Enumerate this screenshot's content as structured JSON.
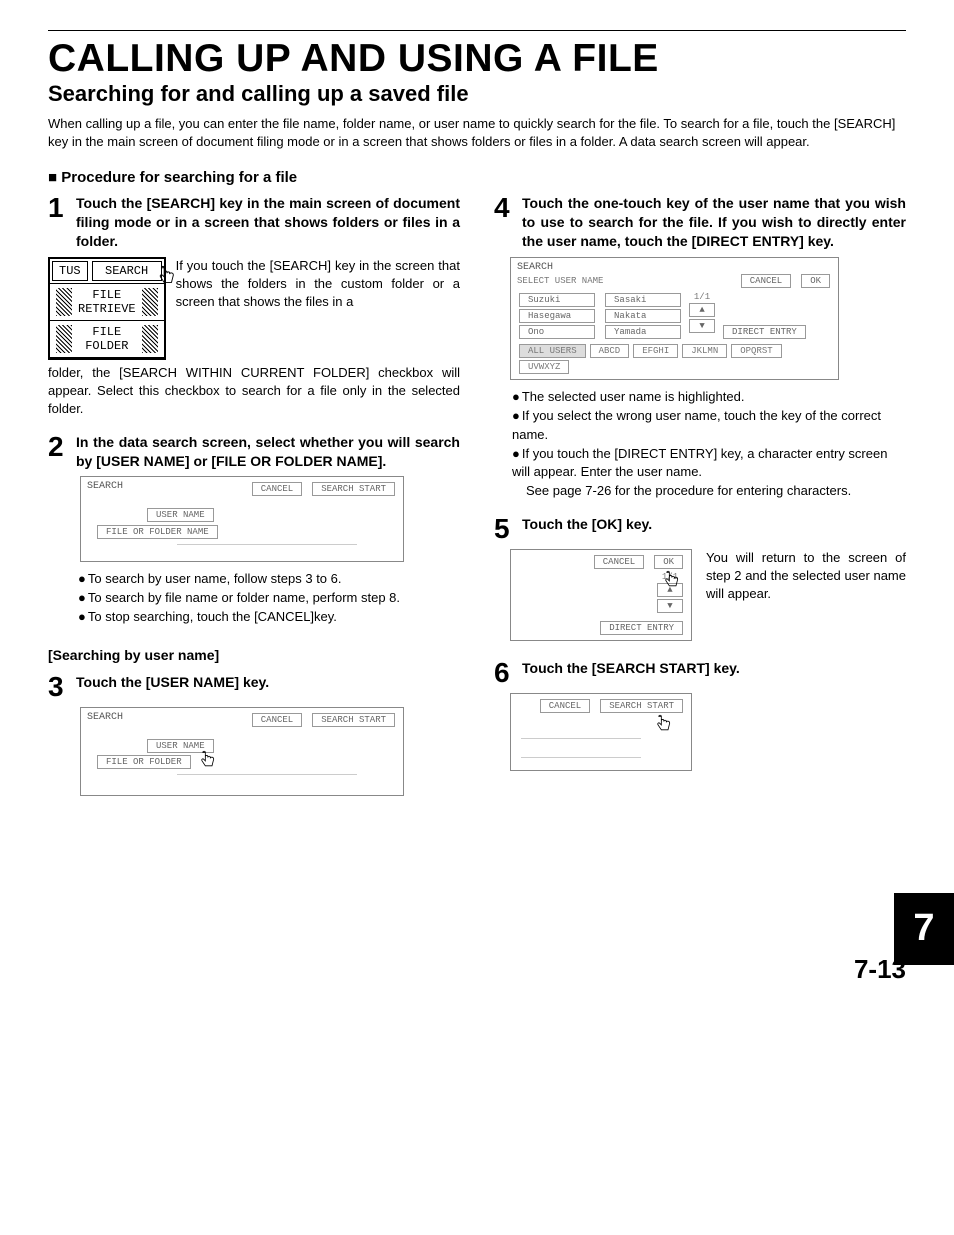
{
  "title": "CALLING UP AND USING A FILE",
  "subtitle": "Searching for and calling up a saved file",
  "intro": "When calling up a file, you can enter the file name, folder name, or user name to quickly search for the file. To search for a file, touch the [SEARCH] key in the main screen of document filing mode or in a screen that shows folders or files in a folder. A data search screen will appear.",
  "proc_heading": "Procedure for searching for a file",
  "step1": {
    "h": "Touch the [SEARCH] key in the main screen of document filing mode or in a screen that shows folders or files in a folder.",
    "body": "If you touch the [SEARCH] key in the screen that shows the folders in the custom folder or a screen that shows the files in a folder, the [SEARCH WITHIN CURRENT FOLDER] checkbox will appear. Select this checkbox to search for a file only in the selected folder.",
    "tab1": "TUS",
    "tab2": "SEARCH",
    "row2": "FILE RETRIEVE",
    "row3": "FILE FOLDER"
  },
  "step2": {
    "h": "In the data search screen, select whether you will search by [USER NAME] or [FILE OR FOLDER NAME].",
    "panel_title": "SEARCH",
    "cancel": "CANCEL",
    "start": "SEARCH START",
    "uname": "USER NAME",
    "forf": "FILE OR FOLDER NAME",
    "b1": "To search by user name, follow steps 3 to 6.",
    "b2": "To search by file name or folder name, perform step 8.",
    "b3": "To stop searching, touch the [CANCEL]key."
  },
  "sub_search_user": "[Searching by user name]",
  "step3": {
    "h": "Touch the [USER NAME] key.",
    "panel_title": "SEARCH",
    "cancel": "CANCEL",
    "start": "SEARCH START",
    "uname": "USER NAME",
    "forf": "FILE OR FOLDER"
  },
  "step4": {
    "h": "Touch the one-touch key of the user name that you wish to use to search for the file. If you wish to directly enter the user name, touch the [DIRECT ENTRY] key.",
    "panel_title": "SEARCH",
    "sel": "SELECT USER NAME",
    "cancel": "CANCEL",
    "ok": "OK",
    "page": "1/1",
    "names": [
      "Suzuki",
      "Sasaki",
      "Hasegawa",
      "Nakata",
      "Ono",
      "Yamada"
    ],
    "direct": "DIRECT ENTRY",
    "tabs": [
      "ALL USERS",
      "ABCD",
      "EFGHI",
      "JKLMN",
      "OPQRST",
      "UVWXYZ"
    ],
    "b1": "The selected user name is highlighted.",
    "b2": "If you select the wrong user name, touch the key of the correct name.",
    "b3": "If you touch the [DIRECT ENTRY] key, a character entry screen will appear. Enter the user name.",
    "b3sub": "See page 7-26 for the procedure for entering characters."
  },
  "step5": {
    "h": "Touch the [OK] key.",
    "cancel": "CANCEL",
    "ok": "OK",
    "page": "1/1",
    "direct": "DIRECT ENTRY",
    "body": "You will return to the screen of step 2 and the selected user name will appear."
  },
  "step6": {
    "h": "Touch the [SEARCH START] key.",
    "cancel": "CANCEL",
    "start": "SEARCH START"
  },
  "chapter": "7",
  "pagenum": "7-13"
}
